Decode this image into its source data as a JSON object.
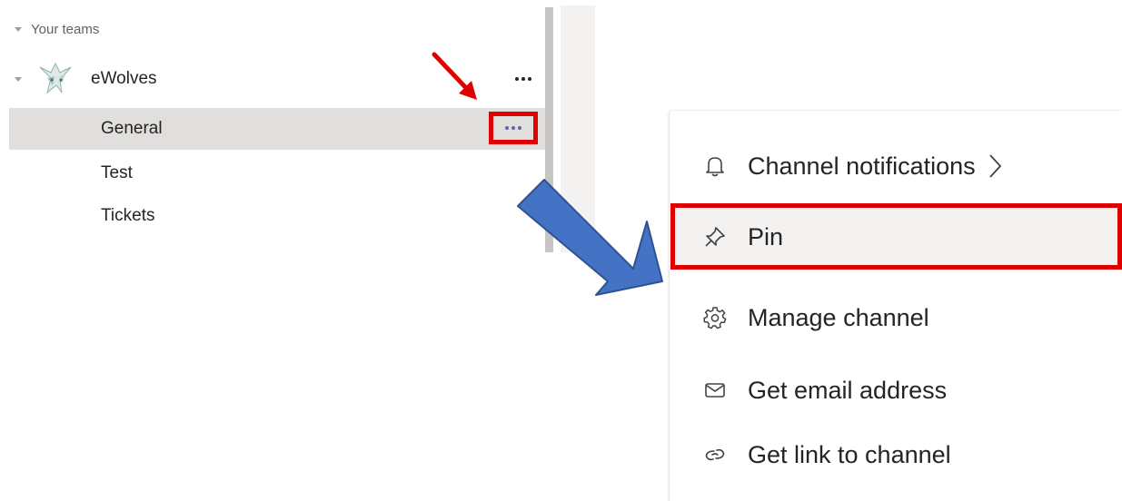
{
  "sidebar": {
    "section_header": "Your teams",
    "team": {
      "name": "eWolves",
      "logo_icon": "wolf-logo-icon",
      "more_icon": "more-options-icon"
    },
    "channels": [
      {
        "label": "General",
        "selected": true
      },
      {
        "label": "Test",
        "selected": false
      },
      {
        "label": "Tickets",
        "selected": false
      }
    ]
  },
  "context_menu": {
    "items": [
      {
        "label": "Channel notifications",
        "icon": "bell-icon",
        "has_submenu": true
      },
      {
        "label": "Pin",
        "icon": "pin-icon",
        "highlighted": true
      },
      {
        "label": "Manage channel",
        "icon": "gear-icon"
      },
      {
        "label": "Get email address",
        "icon": "mail-icon"
      },
      {
        "label": "Get link to channel",
        "icon": "link-icon"
      }
    ]
  },
  "colors": {
    "highlight_red": "#e00000",
    "arrow_blue": "#4472c4",
    "arrow_blue_border": "#2f528f",
    "selected_row": "#e1dfdd",
    "accent_purple": "#6264a7"
  }
}
